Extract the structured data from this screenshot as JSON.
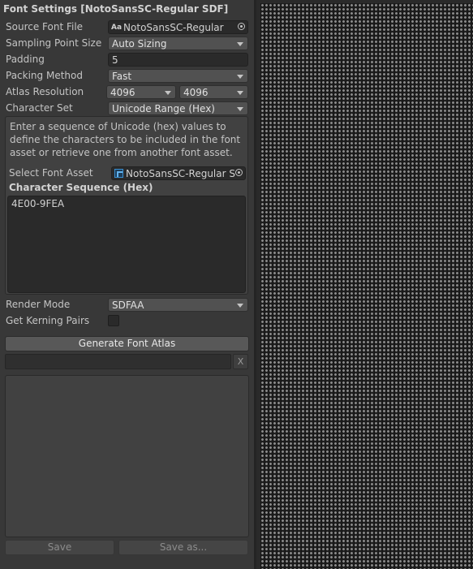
{
  "window_title": "Font Settings [NotoSansSC-Regular SDF]",
  "source_font_file": {
    "label": "Source Font File",
    "value": "NotoSansSC-Regular",
    "icon": "font-file-icon"
  },
  "sampling_point_size": {
    "label": "Sampling Point Size",
    "value": "Auto Sizing"
  },
  "padding": {
    "label": "Padding",
    "value": "5"
  },
  "packing_method": {
    "label": "Packing Method",
    "value": "Fast"
  },
  "atlas_resolution": {
    "label": "Atlas Resolution",
    "width": "4096",
    "height": "4096"
  },
  "character_set": {
    "label": "Character Set",
    "value": "Unicode Range (Hex)"
  },
  "help_text": "Enter a sequence of Unicode (hex) values to define the characters to be included in the font asset or retrieve one from another font asset.",
  "select_font_asset": {
    "label": "Select Font Asset",
    "value": "NotoSansSC-Regular S",
    "icon": "font-asset-icon"
  },
  "character_sequence": {
    "label": "Character Sequence (Hex)",
    "value": "4E00-9FEA"
  },
  "render_mode": {
    "label": "Render Mode",
    "value": "SDFAA"
  },
  "get_kerning_pairs": {
    "label": "Get Kerning Pairs",
    "checked": false
  },
  "generate_button": "Generate Font Atlas",
  "progress": {
    "fraction": 0.0,
    "cancel_label": "X",
    "fill_color": "#4a7ab0"
  },
  "output_log": "",
  "save_button": "Save",
  "save_as_button": "Save as...",
  "colors": {
    "panel_bg": "#383838",
    "field_bg": "#2a2a2a",
    "dropdown_bg": "#515151",
    "text": "#c4c4c4"
  }
}
